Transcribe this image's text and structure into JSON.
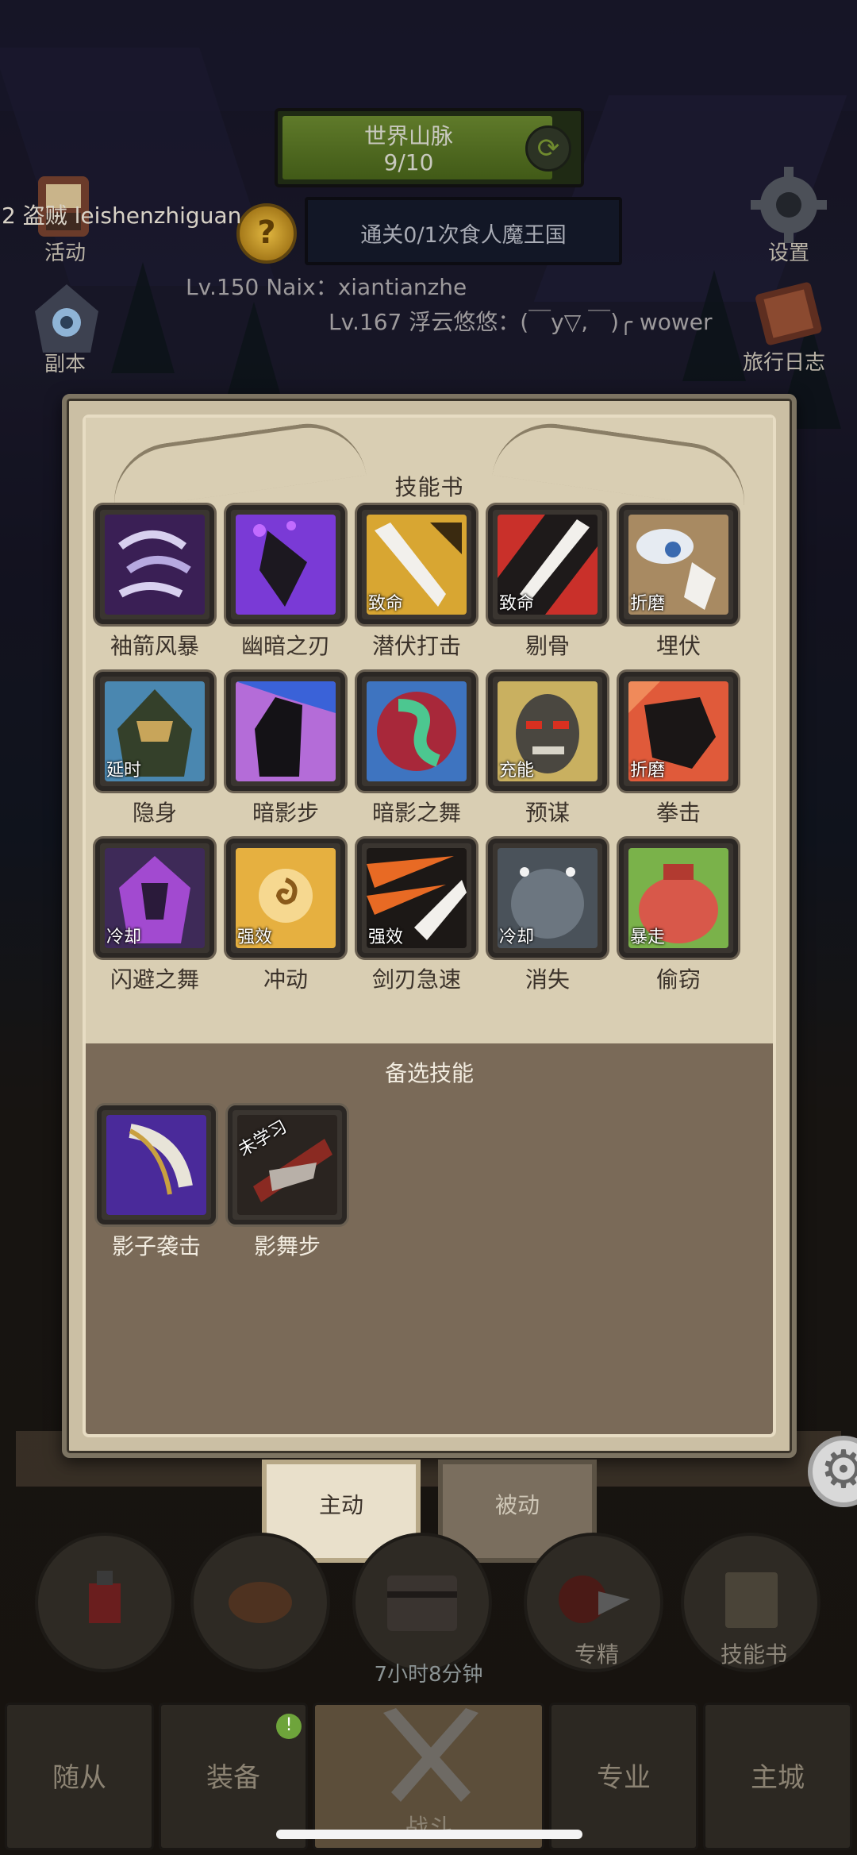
{
  "top": {
    "world_name": "世界山脉",
    "world_count": "9/10",
    "quest_text": "通关0/1次食人魔王国",
    "quest_icon": "?"
  },
  "left_side": {
    "chat_line": "2 盗贼  leishenzhiguan",
    "activity_label": "活动",
    "dungeon_label": "副本"
  },
  "right_side": {
    "settings_label": "设置",
    "journal_label": "旅行日志"
  },
  "players": {
    "line1": "Lv.150 Naix：xiantianzhe",
    "line2": "Lv.167 浮云悠悠：(￣y▽,￣)╭ wower"
  },
  "modal": {
    "title": "技能书",
    "skills": [
      {
        "label": "袖箭风暴",
        "tag": "",
        "icon": "sleeve-arrow-storm-icon"
      },
      {
        "label": "幽暗之刃",
        "tag": "",
        "icon": "dark-blade-icon"
      },
      {
        "label": "潜伏打击",
        "tag": "致命",
        "icon": "ambush-strike-icon"
      },
      {
        "label": "剔骨",
        "tag": "致命",
        "icon": "bone-cut-icon"
      },
      {
        "label": "埋伏",
        "tag": "折磨",
        "icon": "ambush-icon"
      },
      {
        "label": "隐身",
        "tag": "延时",
        "icon": "stealth-icon"
      },
      {
        "label": "暗影步",
        "tag": "",
        "icon": "shadow-step-icon"
      },
      {
        "label": "暗影之舞",
        "tag": "",
        "icon": "shadow-dance-icon"
      },
      {
        "label": "预谋",
        "tag": "充能",
        "icon": "premeditation-icon"
      },
      {
        "label": "拳击",
        "tag": "折磨",
        "icon": "punch-icon"
      },
      {
        "label": "闪避之舞",
        "tag": "冷却",
        "icon": "evasion-dance-icon"
      },
      {
        "label": "冲动",
        "tag": "强效",
        "icon": "impulse-icon"
      },
      {
        "label": "剑刃急速",
        "tag": "强效",
        "icon": "blade-haste-icon"
      },
      {
        "label": "消失",
        "tag": "冷却",
        "icon": "vanish-icon"
      },
      {
        "label": "偷窃",
        "tag": "暴走",
        "icon": "steal-icon"
      }
    ],
    "alt_title": "备选技能",
    "alt_skills": [
      {
        "label": "影子袭击",
        "tag": "",
        "icon": "shadow-strike-icon"
      },
      {
        "label": "影舞步",
        "tag": "未学习",
        "icon": "shadow-dance-step-icon"
      }
    ]
  },
  "tabs": {
    "active": "主动",
    "inactive": "被动"
  },
  "bottom": {
    "specialization_label": "专精",
    "skillbook_label": "技能书",
    "timer": "7小时8分钟"
  },
  "nav": {
    "followers": "随从",
    "equipment": "装备",
    "battle": "战斗",
    "profession": "专业",
    "main_city": "主城",
    "badge": "!"
  },
  "colors": {
    "panel": "#d9ceb3",
    "alt_panel": "#7a6a58",
    "title_text": "#3b322a",
    "world_bar": "#4f6a20"
  }
}
